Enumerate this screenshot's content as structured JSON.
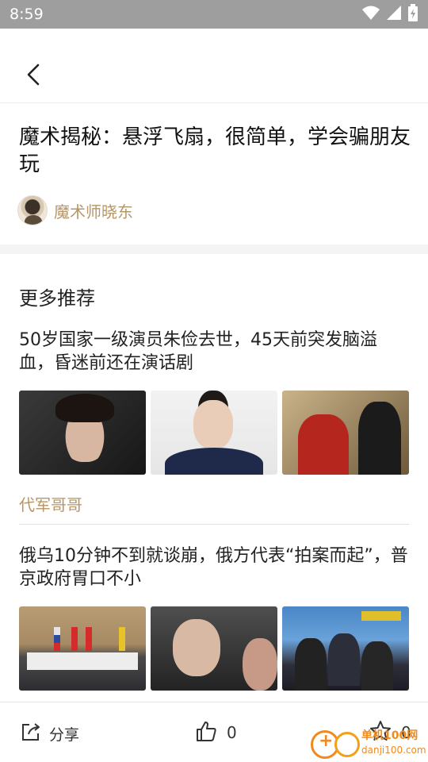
{
  "status_bar": {
    "time": "8:59",
    "icons": [
      "wifi-icon",
      "signal-icon",
      "battery-icon"
    ]
  },
  "top_bar": {
    "back_icon": "chevron-left-icon"
  },
  "article": {
    "title": "魔术揭秘：悬浮飞扇，很简单，学会骗朋友玩",
    "author": "魔术师晓东"
  },
  "more": {
    "heading": "更多推荐",
    "items": [
      {
        "title": "50岁国家一级演员朱俭去世，45天前突发脑溢血，昏迷前还在演话剧",
        "source": "代军哥哥"
      },
      {
        "title": "俄乌10分钟不到就谈崩，俄方代表“拍案而起”，普京政府胃口不小",
        "source": ""
      }
    ]
  },
  "bottom_bar": {
    "share_label": "分享",
    "like_count": "0",
    "favorite_count": "0"
  },
  "watermark": {
    "name": "单机100网",
    "url": "danji100.com"
  },
  "colors": {
    "accent": "#b69567",
    "status_bar": "#9e9e9e",
    "divider": "#e0e0e0"
  }
}
